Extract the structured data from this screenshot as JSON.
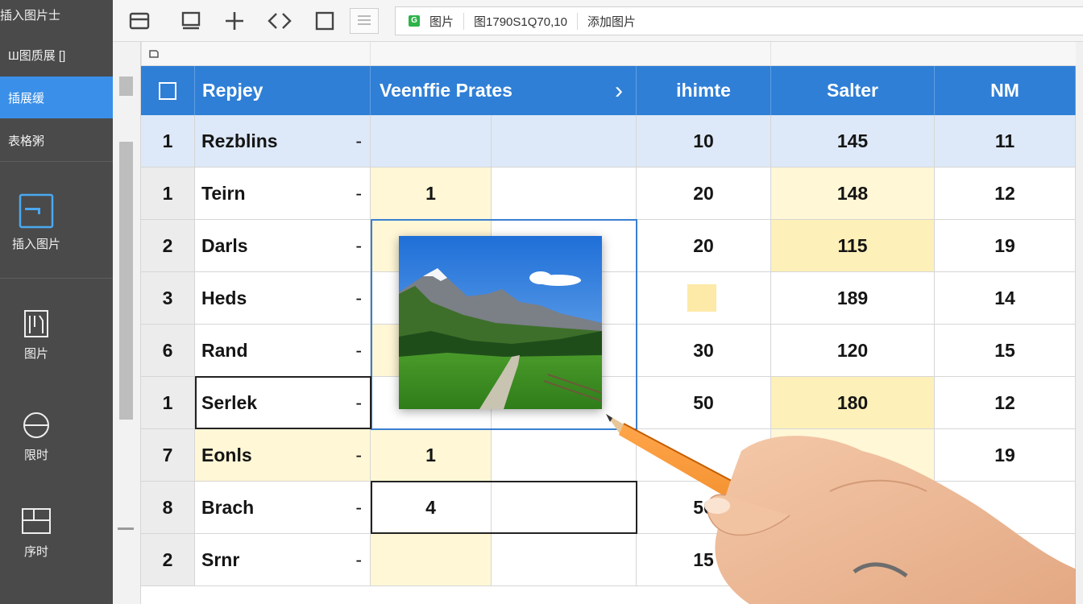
{
  "sidebar": {
    "items": [
      {
        "label": "插入图片士"
      },
      {
        "label": "Ш图质展 []"
      },
      {
        "label": "插展缓"
      },
      {
        "label": "表格粥"
      }
    ],
    "tools": [
      {
        "label": "插入图片",
        "icon": "image-insert-icon"
      },
      {
        "label": "图片",
        "icon": "picture-frame-icon"
      },
      {
        "label": "限时",
        "icon": "circle-minus-icon"
      },
      {
        "label": "序时",
        "icon": "layout-icon"
      }
    ]
  },
  "toolbar": {
    "buttons": [
      "save-icon",
      "monitor-icon",
      "plus-icon",
      "code-icon",
      "square-icon",
      "list-icon"
    ]
  },
  "formula_bar": {
    "tag": "G",
    "cell_ref": "图片",
    "value": "图1790S1Q70,10",
    "label": "添加图片"
  },
  "sheet": {
    "columns": [
      "Repjey",
      "Veenffie Prates",
      "ihimte",
      "Salter",
      "NM"
    ],
    "header_arrow": "›",
    "rows": [
      {
        "num": "1",
        "name": "Rezblins",
        "dash": "-",
        "b": "",
        "c": "10",
        "d": "145",
        "e": "11"
      },
      {
        "num": "1",
        "name": "Teirn",
        "dash": "-",
        "b": "1",
        "c": "20",
        "d": "148",
        "e": "12"
      },
      {
        "num": "2",
        "name": "Darls",
        "dash": "-",
        "b": "",
        "c": "20",
        "d": "115",
        "e": "19"
      },
      {
        "num": "3",
        "name": "Heds",
        "dash": "-",
        "b": "",
        "c": "",
        "d": "189",
        "e": "14"
      },
      {
        "num": "6",
        "name": "Rand",
        "dash": "-",
        "b": "",
        "c": "30",
        "d": "120",
        "e": "15"
      },
      {
        "num": "1",
        "name": "Serlek",
        "dash": "-",
        "b": "",
        "c": "50",
        "d": "180",
        "e": "12"
      },
      {
        "num": "7",
        "name": "Eonls",
        "dash": "-",
        "b": "1",
        "c": "",
        "d": "",
        "e": "19"
      },
      {
        "num": "8",
        "name": "Brach",
        "dash": "-",
        "b": "4",
        "c": "50",
        "d": "",
        "e": ""
      },
      {
        "num": "2",
        "name": "Srnr",
        "dash": "-",
        "b": "",
        "c": "15",
        "d": "",
        "e": ""
      }
    ]
  },
  "colors": {
    "header": "#2f7fd6",
    "sidebar": "#4a4a4a",
    "sidebar_active": "#3a8fe8",
    "highlight_yellow": "#fdf0b8"
  }
}
